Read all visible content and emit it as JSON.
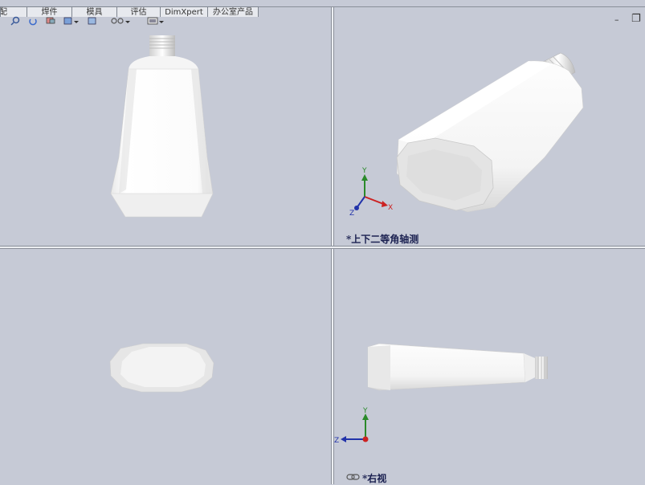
{
  "tabs": [
    {
      "label": "装配"
    },
    {
      "label": "焊件"
    },
    {
      "label": "模具"
    },
    {
      "label": "评估"
    },
    {
      "label": "DimXpert"
    },
    {
      "label": "办公室产品"
    }
  ],
  "toolbar": {
    "icons": [
      "zoom-icon",
      "rotate-icon",
      "section-view-icon",
      "view-orientation-icon",
      "display-style-icon",
      "hide-show-icon",
      "appearance-icon"
    ]
  },
  "views": {
    "top_right_label": "*上下二等角轴测",
    "bottom_right_label": "*右视"
  },
  "triad_top": {
    "y": "Y",
    "x": "X",
    "z": "Z"
  },
  "triad_bottom": {
    "y": "Y",
    "z": "Z"
  },
  "window_controls": {
    "minimize": "–",
    "restore": "❐"
  },
  "colors": {
    "background": "#c6cad6",
    "x_axis": "#cc2222",
    "y_axis": "#2a8a2a",
    "z_axis": "#2233aa"
  }
}
